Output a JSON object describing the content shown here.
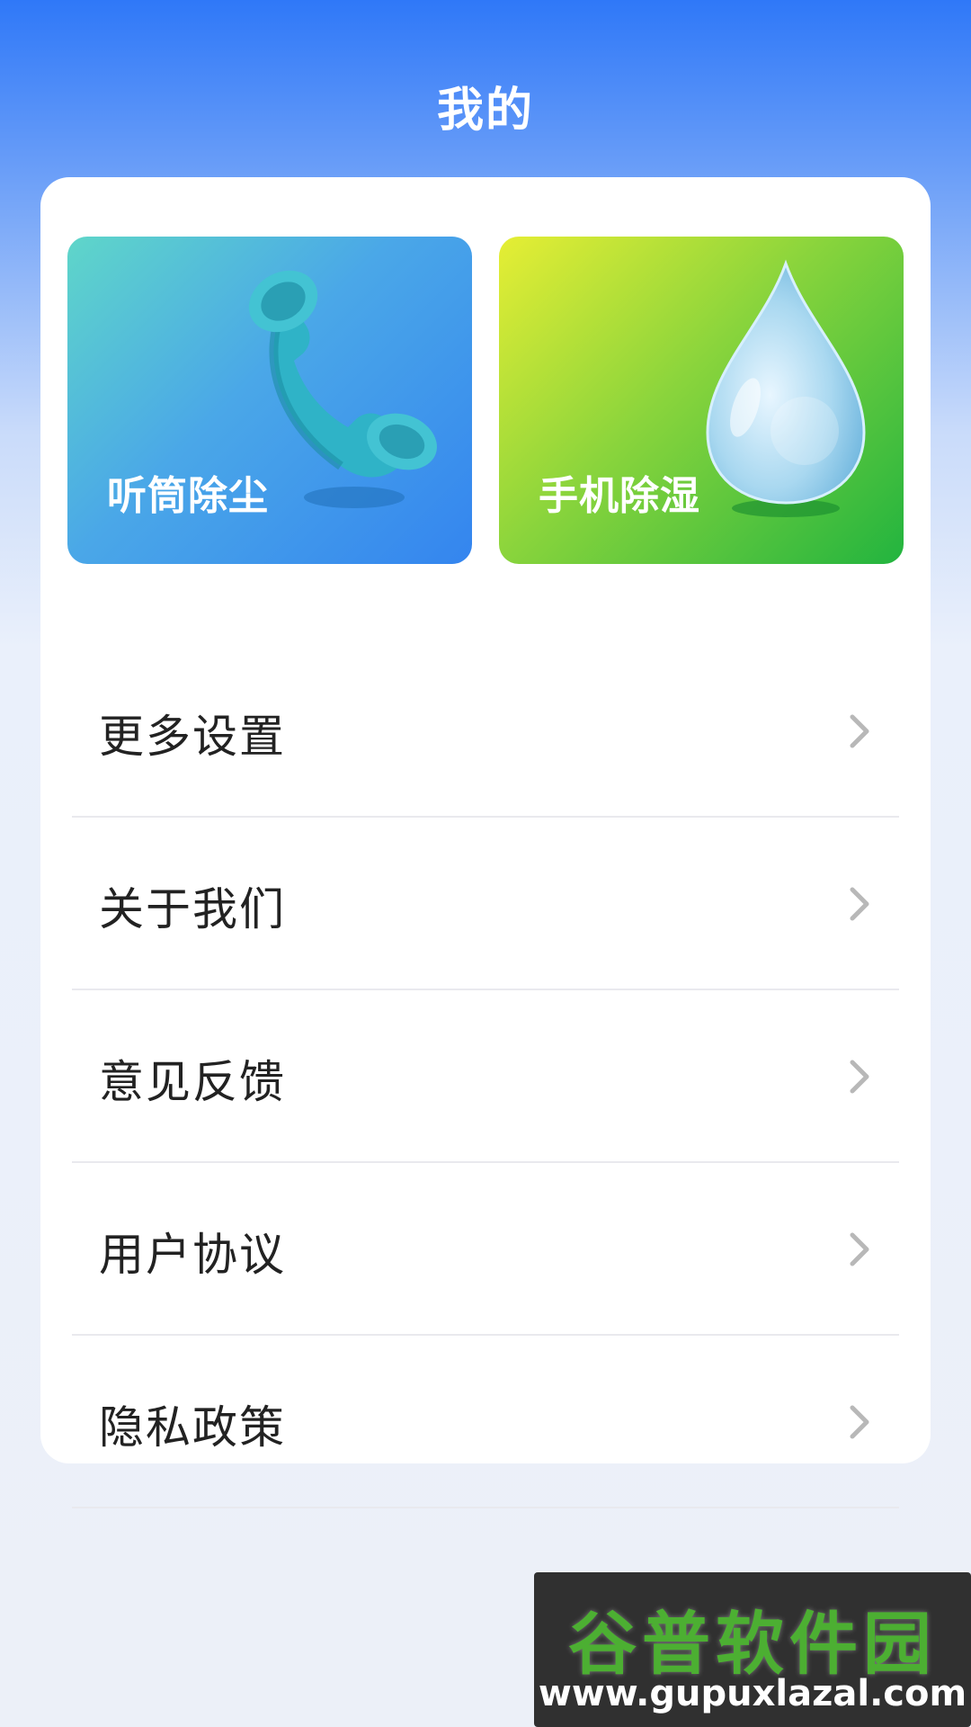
{
  "header": {
    "title": "我的"
  },
  "tiles": [
    {
      "label": "听筒除尘",
      "icon": "telephone-receiver-icon"
    },
    {
      "label": "手机除湿",
      "icon": "water-drop-icon"
    }
  ],
  "menu": {
    "items": [
      {
        "label": "更多设置"
      },
      {
        "label": "关于我们"
      },
      {
        "label": "意见反馈"
      },
      {
        "label": "用户协议"
      },
      {
        "label": "隐私政策"
      }
    ]
  },
  "watermark": {
    "brand": "谷普软件园",
    "url": "www.gupuxlazal.com"
  },
  "colors": {
    "header_blue": "#2f78f8",
    "tile_left": "#3485ef",
    "tile_right": "#22b43f",
    "text": "#222222",
    "chevron": "#b8b8b8"
  }
}
